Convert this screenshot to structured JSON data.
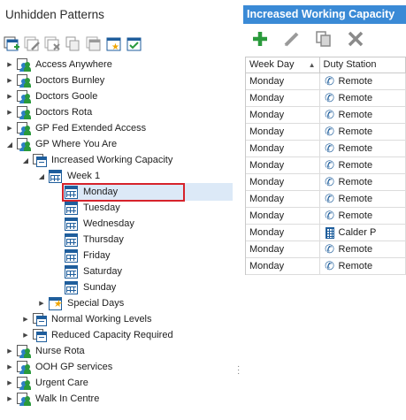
{
  "left_panel": {
    "title": "Unhidden Patterns",
    "toolbar_icons": [
      "add-pattern-icon",
      "edit-pattern-icon",
      "delete-pattern-icon",
      "copy-pattern-icon",
      "hide-pattern-icon",
      "special-days-icon",
      "calendar-check-icon"
    ]
  },
  "tree": [
    {
      "label": "Access Anywhere",
      "icon": "people-icon",
      "expanded": false
    },
    {
      "label": "Doctors Burnley",
      "icon": "people-icon",
      "expanded": false
    },
    {
      "label": "Doctors Goole",
      "icon": "people-icon",
      "expanded": false
    },
    {
      "label": "Doctors Rota",
      "icon": "people-icon",
      "expanded": false
    },
    {
      "label": "GP Fed Extended Access",
      "icon": "people-icon",
      "expanded": false
    },
    {
      "label": "GP Where You Are",
      "icon": "people-icon",
      "expanded": true
    },
    {
      "label": "Increased Working Capacity",
      "icon": "pattern-icon",
      "expanded": true
    },
    {
      "label": "Week 1",
      "icon": "calendar-icon",
      "expanded": true
    },
    {
      "label": "Monday",
      "icon": "calendar-icon",
      "selected": true
    },
    {
      "label": "Tuesday",
      "icon": "calendar-icon"
    },
    {
      "label": "Wednesday",
      "icon": "calendar-icon"
    },
    {
      "label": "Thursday",
      "icon": "calendar-icon"
    },
    {
      "label": "Friday",
      "icon": "calendar-icon"
    },
    {
      "label": "Saturday",
      "icon": "calendar-icon"
    },
    {
      "label": "Sunday",
      "icon": "calendar-icon"
    },
    {
      "label": "Special Days",
      "icon": "special-days-icon",
      "expanded": false
    },
    {
      "label": "Normal Working Levels",
      "icon": "pattern-icon",
      "expanded": false
    },
    {
      "label": "Reduced Capacity Required",
      "icon": "pattern-icon",
      "expanded": false
    },
    {
      "label": "Nurse Rota",
      "icon": "people-icon",
      "expanded": false
    },
    {
      "label": "OOH GP services",
      "icon": "people-icon",
      "expanded": false
    },
    {
      "label": "Urgent Care",
      "icon": "people-icon",
      "expanded": false
    },
    {
      "label": "Walk In Centre",
      "icon": "people-icon",
      "expanded": false
    }
  ],
  "right_panel": {
    "title": "Increased Working Capacity",
    "toolbar_icons": [
      "add-icon",
      "edit-icon",
      "copy-icon",
      "delete-icon"
    ],
    "columns": [
      "Week Day",
      "Duty Station"
    ],
    "rows": [
      {
        "day": "Monday",
        "station": "Remote",
        "station_icon": "phone-icon"
      },
      {
        "day": "Monday",
        "station": "Remote",
        "station_icon": "phone-icon"
      },
      {
        "day": "Monday",
        "station": "Remote",
        "station_icon": "phone-icon"
      },
      {
        "day": "Monday",
        "station": "Remote",
        "station_icon": "phone-icon"
      },
      {
        "day": "Monday",
        "station": "Remote",
        "station_icon": "phone-icon"
      },
      {
        "day": "Monday",
        "station": "Remote",
        "station_icon": "phone-icon"
      },
      {
        "day": "Monday",
        "station": "Remote",
        "station_icon": "phone-icon"
      },
      {
        "day": "Monday",
        "station": "Remote",
        "station_icon": "phone-icon"
      },
      {
        "day": "Monday",
        "station": "Remote",
        "station_icon": "phone-icon"
      },
      {
        "day": "Monday",
        "station": "Calder P",
        "station_icon": "building-icon"
      },
      {
        "day": "Monday",
        "station": "Remote",
        "station_icon": "phone-icon"
      },
      {
        "day": "Monday",
        "station": "Remote",
        "station_icon": "phone-icon"
      }
    ]
  },
  "colors": {
    "accent": "#3a8ad6",
    "selection": "#dce9f7",
    "highlight_border": "#d6232b",
    "add_green": "#2a9a3c"
  }
}
